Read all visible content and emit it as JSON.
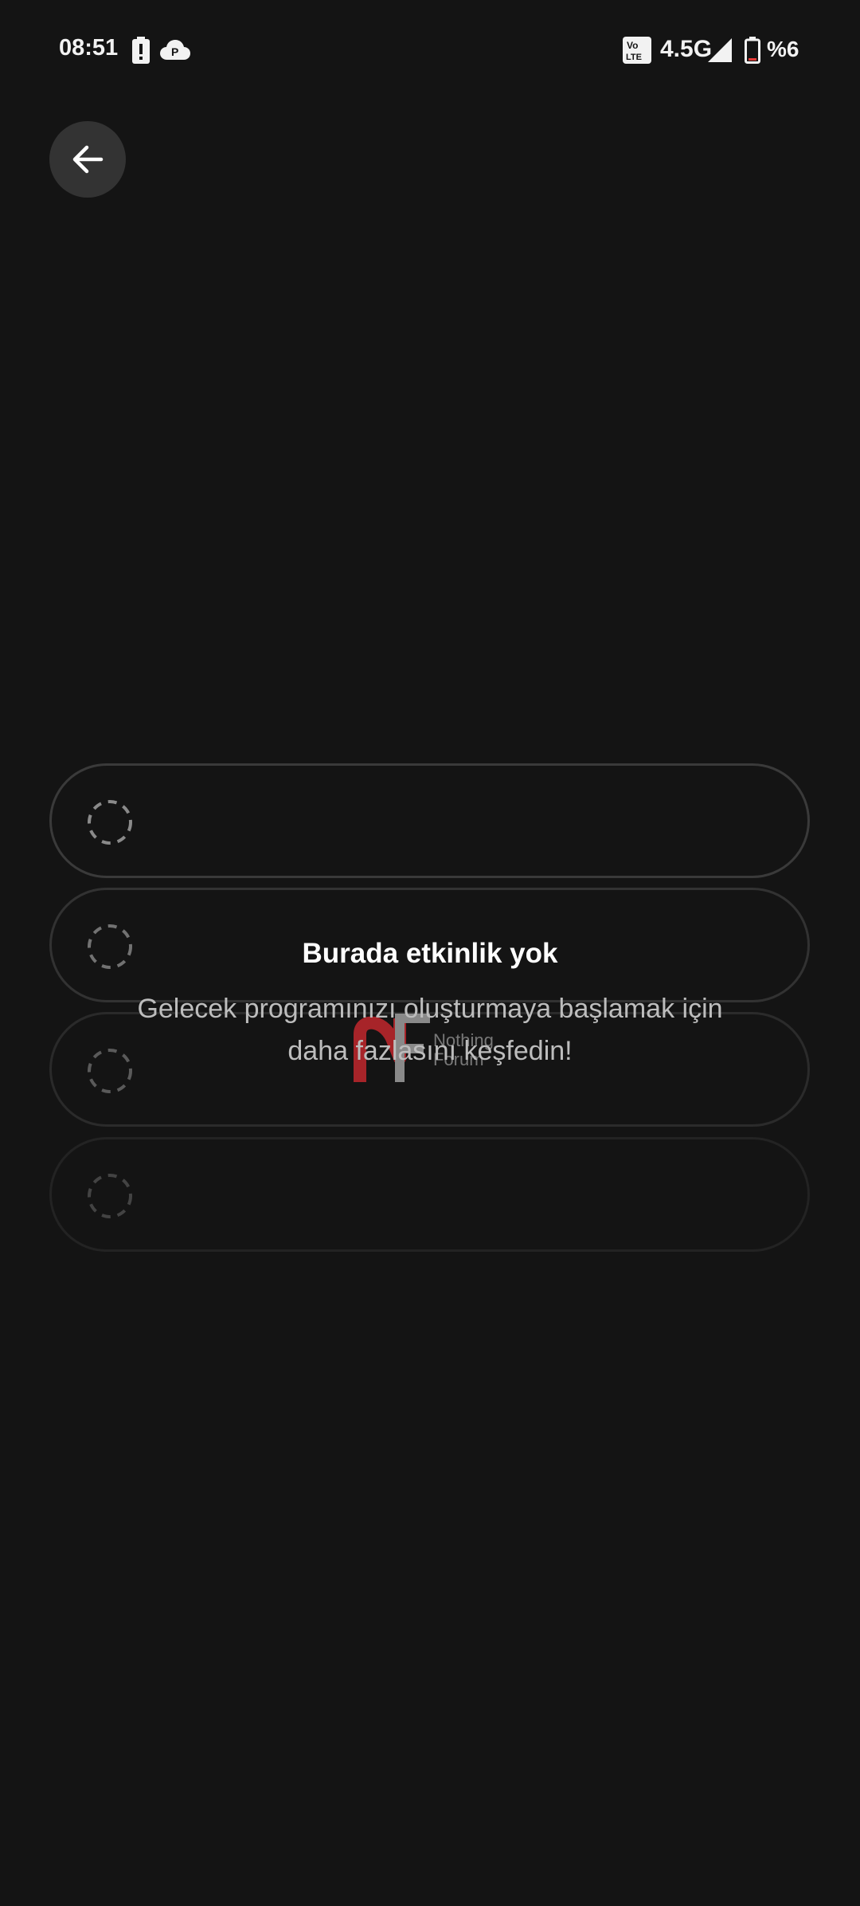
{
  "status_bar": {
    "time": "08:51",
    "network": "4.5G",
    "battery": "%6",
    "volte": "VoLTE",
    "icons": [
      "alert-battery-icon",
      "cloud-p-icon",
      "volte-icon",
      "signal-icon",
      "battery-icon"
    ]
  },
  "header": {
    "back_icon": "arrow-left-icon"
  },
  "empty_state": {
    "title": "Burada etkinlik yok",
    "subtitle": "Gelecek programınızı oluşturmaya başlamak için daha fazlasını keşfedin!"
  },
  "placeholders": [
    {
      "icon": "dashed-circle-icon"
    },
    {
      "icon": "dashed-circle-icon"
    },
    {
      "icon": "dashed-circle-icon"
    },
    {
      "icon": "dashed-circle-icon"
    }
  ],
  "watermark": {
    "line1": "Nothing",
    "line2": "Forum"
  },
  "colors": {
    "background": "#141414",
    "button": "#333333",
    "pill_border": "#3a3a3a",
    "watermark_red": "#c1272d"
  }
}
